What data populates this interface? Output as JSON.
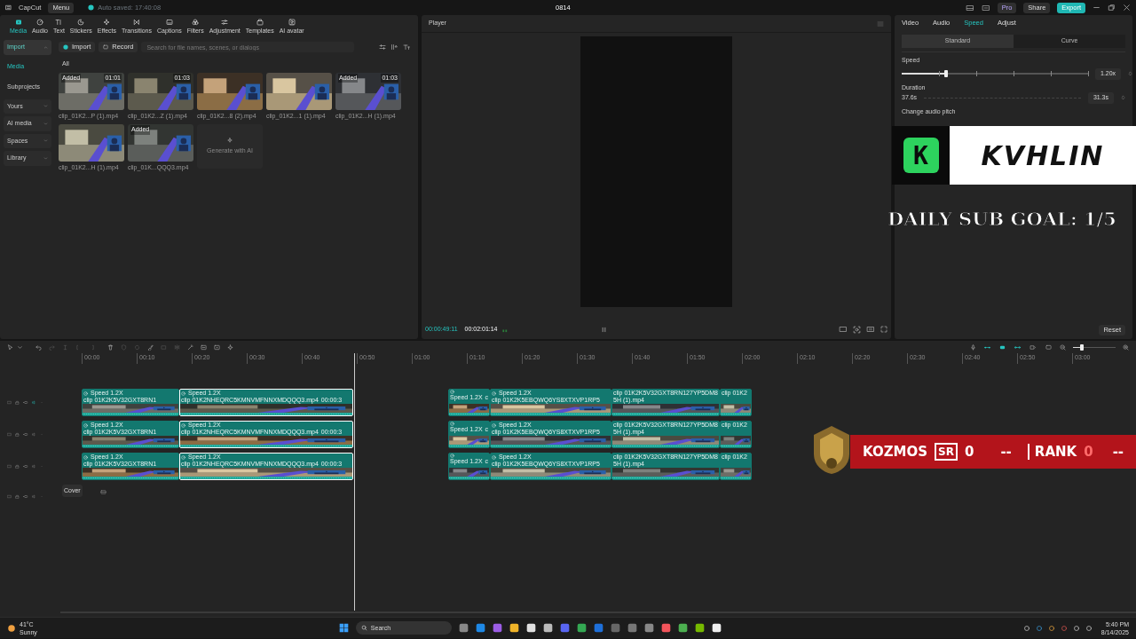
{
  "title_bar": {
    "app_name": "CapCut",
    "menu": "Menu",
    "autosave": "Auto saved: 17:40:08",
    "project_name": "0814",
    "pro": "Pro",
    "share": "Share",
    "export": "Export"
  },
  "media_tabs": [
    {
      "label": "Media",
      "selected": true
    },
    {
      "label": "Audio",
      "selected": false
    },
    {
      "label": "Text",
      "selected": false
    },
    {
      "label": "Stickers",
      "selected": false
    },
    {
      "label": "Effects",
      "selected": false
    },
    {
      "label": "Transitions",
      "selected": false
    },
    {
      "label": "Captions",
      "selected": false
    },
    {
      "label": "Filters",
      "selected": false
    },
    {
      "label": "Adjustment",
      "selected": false
    },
    {
      "label": "Templates",
      "selected": false
    },
    {
      "label": "AI avatar",
      "selected": false
    }
  ],
  "sidebar": [
    {
      "label": "Import",
      "kind": "group",
      "expanded": true
    },
    {
      "label": "Media",
      "kind": "item",
      "selected": true
    },
    {
      "label": "Subprojects",
      "kind": "item",
      "selected": false
    },
    {
      "label": "Yours",
      "kind": "group",
      "expanded": false
    },
    {
      "label": "AI media",
      "kind": "group",
      "expanded": false
    },
    {
      "label": "Spaces",
      "kind": "group",
      "expanded": false
    },
    {
      "label": "Library",
      "kind": "group",
      "expanded": false
    }
  ],
  "media_bar": {
    "import": "Import",
    "record": "Record",
    "search_placeholder": "Search for file names, scenes, or dialogs"
  },
  "media_filter": "All",
  "media_items": [
    {
      "name": "clip_01K2...P (1).mp4",
      "badge": "Added",
      "duration": "01:01"
    },
    {
      "name": "clip_01K2...Z (1).mp4",
      "duration": "01:03"
    },
    {
      "name": "clip_01K2...8 (2).mp4"
    },
    {
      "name": "clip_01K2...1 (1).mp4"
    },
    {
      "name": "clip_01K2...H (1).mp4",
      "badge": "Added",
      "duration": "01:03"
    },
    {
      "name": "clip_01K2...H (1).mp4"
    },
    {
      "name": "clip_01K...QQQ3.mp4",
      "badge": "Added"
    }
  ],
  "generate": "Generate with AI",
  "player": {
    "title": "Player",
    "current_time": "00:00:49:11",
    "total_time": "00:02:01:14"
  },
  "inspector": {
    "tabs": [
      {
        "label": "Video",
        "selected": false
      },
      {
        "label": "Audio",
        "selected": false
      },
      {
        "label": "Speed",
        "selected": true
      },
      {
        "label": "Adjust",
        "selected": false
      }
    ],
    "modes": [
      {
        "label": "Standard",
        "selected": true
      },
      {
        "label": "Curve",
        "selected": false
      }
    ],
    "speed_label": "Speed",
    "speed": {
      "level": 0.24,
      "value": "1.20x"
    },
    "duration_label": "Duration",
    "duration_from": "37.6s",
    "duration_to": "31.3s",
    "pitch_label": "Change audio pitch",
    "reset": "Reset"
  },
  "timeline": {
    "zoom": {
      "level": 0.2
    },
    "ruler": [
      "00:00",
      "00:10",
      "00:20",
      "00:30",
      "00:40",
      "00:50",
      "01:00",
      "01:10",
      "01:20",
      "01:30",
      "01:40",
      "01:50",
      "02:00",
      "02:10",
      "02:20",
      "02:30",
      "02:40",
      "02:50",
      "03:00"
    ],
    "tracks": [
      {
        "clips": [
          {
            "speed": "Speed 1.2X",
            "name": "clip 01K2K5V32GXT8RN1",
            "selected": false
          },
          {
            "speed": "Speed 1.2X",
            "name": "clip 01K2NHEQRC5KMNVMFNNXMDQQQ3.mp4",
            "time": "00:00:3",
            "selected": true
          },
          {
            "speed": "Speed 1.2X",
            "name": "c",
            "selected": false
          },
          {
            "speed": "Speed 1.2X",
            "name": "clip 01K2K5EBQWQ6YS8XTXVP1RP5",
            "selected": false
          },
          {
            "name": "clip 01K2K5V32GXT8RN127YP5DM85H (1).mp4",
            "selected": false
          },
          {
            "name": "clip 01K2",
            "selected": false
          }
        ]
      },
      {
        "clips": [
          {
            "speed": "Speed 1.2X",
            "name": "clip 01K2K5V32GXT8RN1",
            "selected": false
          },
          {
            "speed": "Speed 1.2X",
            "name": "clip 01K2NHEQRC5KMNVMFNNXMDQQQ3.mp4",
            "time": "00:00:3",
            "selected": true
          },
          {
            "speed": "Speed 1.2X",
            "name": "c",
            "selected": false
          },
          {
            "speed": "Speed 1.2X",
            "name": "clip 01K2K5EBQWQ6YS8XTXVP1RP5",
            "selected": false
          },
          {
            "name": "clip 01K2K5V32GXT8RN127YP5DM85H (1).mp4",
            "selected": false
          },
          {
            "name": "clip 01K2",
            "selected": false
          }
        ]
      },
      {
        "clips": [
          {
            "speed": "Speed 1.2X",
            "name": "clip 01K2K5V32GXT8RN1",
            "selected": false
          },
          {
            "speed": "Speed 1.2X",
            "name": "clip 01K2NHEQRC5KMNVMFNNXMDQQQ3.mp4",
            "time": "00:00:3",
            "selected": true
          },
          {
            "speed": "Speed 1.2X",
            "name": "c",
            "selected": false
          },
          {
            "speed": "Speed 1.2X",
            "name": "clip 01K2K5EBQWQ6YS8XTXVP1RP5",
            "selected": false
          },
          {
            "name": "clip 01K2K5V32GXT8RN127YP5DM85H (1).mp4",
            "selected": false
          },
          {
            "name": "clip 01K2",
            "selected": false
          }
        ]
      }
    ],
    "cover": "Cover"
  },
  "overlays": {
    "badge_letter": "K",
    "channel_name": "KVHLIN",
    "sub_goal": "DAILY SUB GOAL: 1/5",
    "rank_bar": {
      "player": "KOZMOS",
      "sr_badge": "SR",
      "sr_value": "0",
      "sr_change": "--",
      "rank_label": "RANK",
      "rank_value": "0",
      "rank_change": "--"
    }
  },
  "taskbar": {
    "temperature": "41°C",
    "weather": "Sunny",
    "search": "Search",
    "time": "5:40 PM",
    "date": "8/14/2025"
  }
}
